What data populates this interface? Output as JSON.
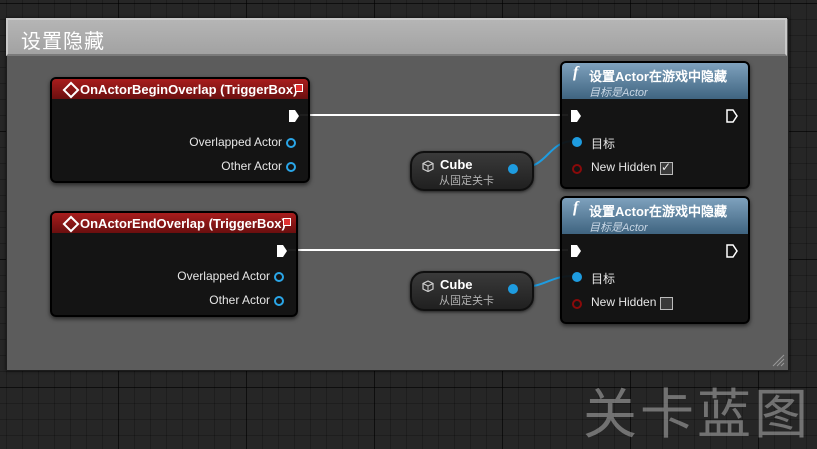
{
  "comment": {
    "title": "设置隐藏"
  },
  "begin_event": {
    "title": "OnActorBeginOverlap (TriggerBox)",
    "pins": [
      "Overlapped Actor",
      "Other Actor"
    ]
  },
  "end_event": {
    "title": "OnActorEndOverlap (TriggerBox)",
    "pins": [
      "Overlapped Actor",
      "Other Actor"
    ]
  },
  "cube_ref_1": {
    "name": "Cube",
    "subtitle": "从固定关卡"
  },
  "cube_ref_2": {
    "name": "Cube",
    "subtitle": "从固定关卡"
  },
  "set_hidden_1": {
    "title": "设置Actor在游戏中隐藏",
    "subtitle": "目标是Actor",
    "target_label": "目标",
    "hidden_label": "New Hidden",
    "hidden_checked": true
  },
  "set_hidden_2": {
    "title": "设置Actor在游戏中隐藏",
    "subtitle": "目标是Actor",
    "target_label": "目标",
    "hidden_label": "New Hidden",
    "hidden_checked": false
  },
  "watermark": "关卡蓝图",
  "colors": {
    "event_header": "#a81d1d",
    "function_header": "#5a7fa0",
    "object_pin": "#1e9ce0",
    "bool_pin": "#8a0a0a",
    "exec_wire": "#ffffff",
    "object_wire": "#1e9ce0"
  },
  "icons": {
    "event": "event-diamond-icon",
    "delegate": "delegate-square-icon",
    "function": "function-f-icon",
    "exec": "exec-arrow-icon",
    "cube": "cube-object-icon"
  }
}
